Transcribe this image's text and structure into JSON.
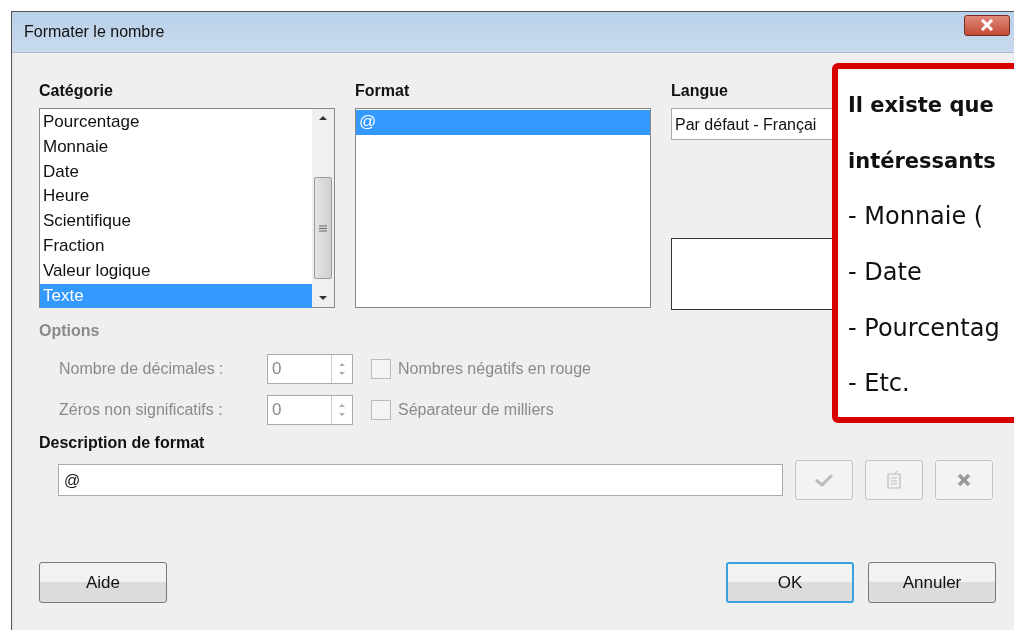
{
  "window": {
    "title": "Formater le nombre"
  },
  "category": {
    "label": "Catégorie",
    "items": [
      {
        "label": "Pourcentage",
        "selected": false
      },
      {
        "label": "Monnaie",
        "selected": false
      },
      {
        "label": "Date",
        "selected": false
      },
      {
        "label": "Heure",
        "selected": false
      },
      {
        "label": "Scientifique",
        "selected": false
      },
      {
        "label": "Fraction",
        "selected": false
      },
      {
        "label": "Valeur logique",
        "selected": false
      },
      {
        "label": "Texte",
        "selected": true
      }
    ]
  },
  "format": {
    "label": "Format",
    "items": [
      {
        "label": "@",
        "selected": true
      }
    ]
  },
  "language": {
    "label": "Langue",
    "value": "Par défaut - Françai"
  },
  "options": {
    "label": "Options",
    "disabled": true,
    "rows": [
      {
        "label": "Nombre de décimales :",
        "value": "0",
        "check_label": "Nombres négatifs en rouge",
        "checked": false
      },
      {
        "label": "Zéros non significatifs :",
        "value": "0",
        "check_label": "Séparateur de milliers",
        "checked": false
      }
    ]
  },
  "description": {
    "label": "Description de format",
    "value": "@"
  },
  "tool_buttons": [
    {
      "kind": "check",
      "disabled": true
    },
    {
      "kind": "comment",
      "disabled": true
    },
    {
      "kind": "delete",
      "disabled": true
    }
  ],
  "buttons": [
    {
      "label": "Aide",
      "default": false
    },
    {
      "label": "OK",
      "default": true
    },
    {
      "label": "Annuler",
      "default": false
    }
  ],
  "callout": {
    "lines": [
      {
        "text": "Il existe que",
        "bold": true
      },
      {
        "text": "intéressants",
        "bold": true
      },
      {
        "text": "- Monnaie (",
        "bold": false
      },
      {
        "text": "- Date",
        "bold": false
      },
      {
        "text": "- Pourcentag",
        "bold": false
      },
      {
        "text": "- Etc.",
        "bold": false
      }
    ]
  }
}
